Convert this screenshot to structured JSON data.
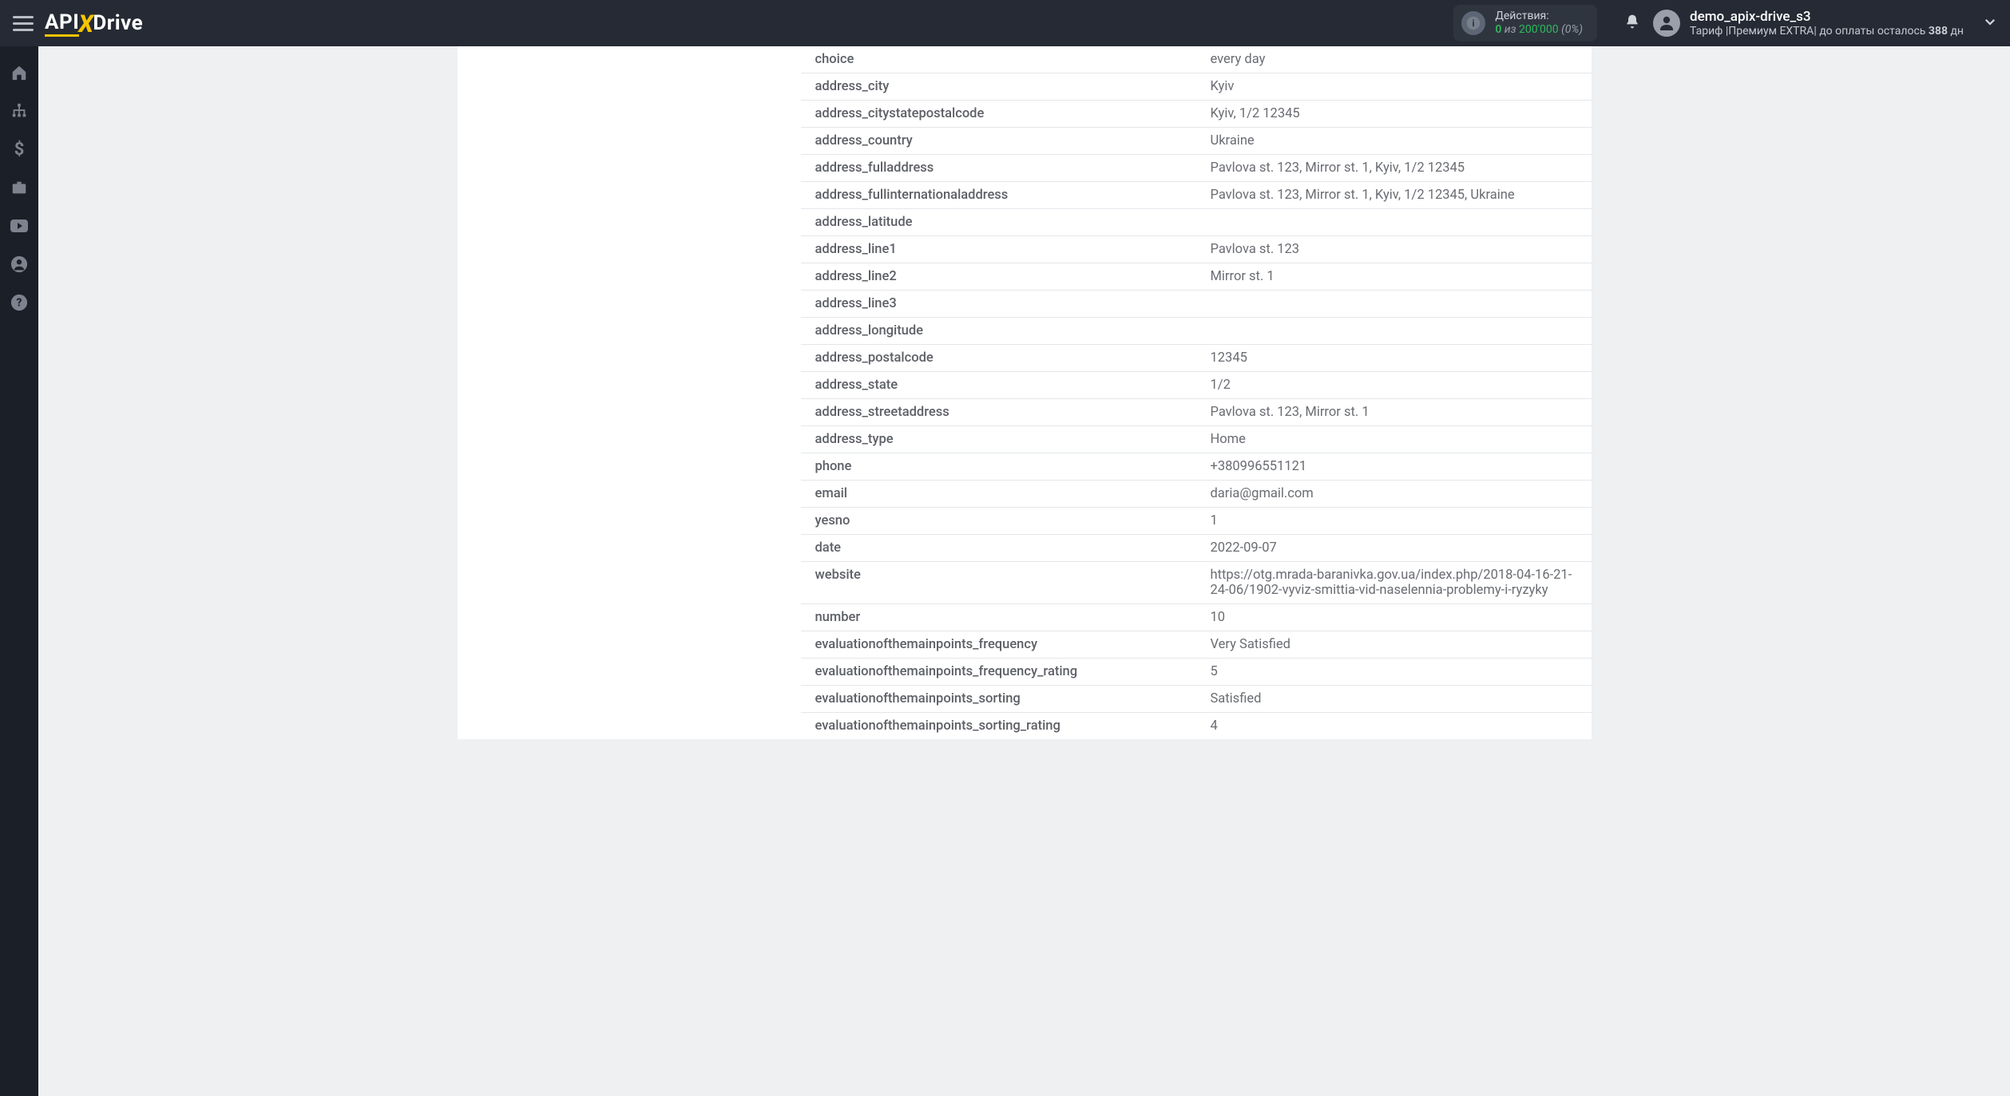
{
  "header": {
    "logo_api": "API",
    "logo_x": "X",
    "logo_drive": "Drive",
    "actions_label": "Действия:",
    "actions_current": "0",
    "actions_of": " из ",
    "actions_max": "200'000",
    "actions_pct": " (0%)",
    "user_name": "demo_apix-drive_s3",
    "tariff_prefix": "Тариф |",
    "tariff_plan": "Премиум EXTRA",
    "tariff_mid": "| до оплаты осталось ",
    "tariff_days": "388",
    "tariff_suffix": " дн"
  },
  "rows": [
    {
      "k": "choice",
      "v": "every day"
    },
    {
      "k": "address_city",
      "v": "Kyiv"
    },
    {
      "k": "address_citystatepostalcode",
      "v": "Kyiv, 1/2 12345"
    },
    {
      "k": "address_country",
      "v": "Ukraine"
    },
    {
      "k": "address_fulladdress",
      "v": "Pavlova st. 123, Mirror st. 1, Kyiv, 1/2 12345"
    },
    {
      "k": "address_fullinternationaladdress",
      "v": "Pavlova st. 123, Mirror st. 1, Kyiv, 1/2 12345, Ukraine"
    },
    {
      "k": "address_latitude",
      "v": ""
    },
    {
      "k": "address_line1",
      "v": "Pavlova st. 123"
    },
    {
      "k": "address_line2",
      "v": "Mirror st. 1"
    },
    {
      "k": "address_line3",
      "v": ""
    },
    {
      "k": "address_longitude",
      "v": ""
    },
    {
      "k": "address_postalcode",
      "v": "12345"
    },
    {
      "k": "address_state",
      "v": "1/2"
    },
    {
      "k": "address_streetaddress",
      "v": "Pavlova st. 123, Mirror st. 1"
    },
    {
      "k": "address_type",
      "v": "Home"
    },
    {
      "k": "phone",
      "v": "+380996551121"
    },
    {
      "k": "email",
      "v": "daria@gmail.com"
    },
    {
      "k": "yesno",
      "v": "1"
    },
    {
      "k": "date",
      "v": "2022-09-07"
    },
    {
      "k": "website",
      "v": "https://otg.mrada-baranivka.gov.ua/index.php/2018-04-16-21-24-06/1902-vyviz-smittia-vid-naselennia-problemy-i-ryzyky"
    },
    {
      "k": "number",
      "v": "10"
    },
    {
      "k": "evaluationofthemainpoints_frequency",
      "v": "Very Satisfied"
    },
    {
      "k": "evaluationofthemainpoints_frequency_rating",
      "v": "5"
    },
    {
      "k": "evaluationofthemainpoints_sorting",
      "v": "Satisfied"
    },
    {
      "k": "evaluationofthemainpoints_sorting_rating",
      "v": "4"
    }
  ]
}
